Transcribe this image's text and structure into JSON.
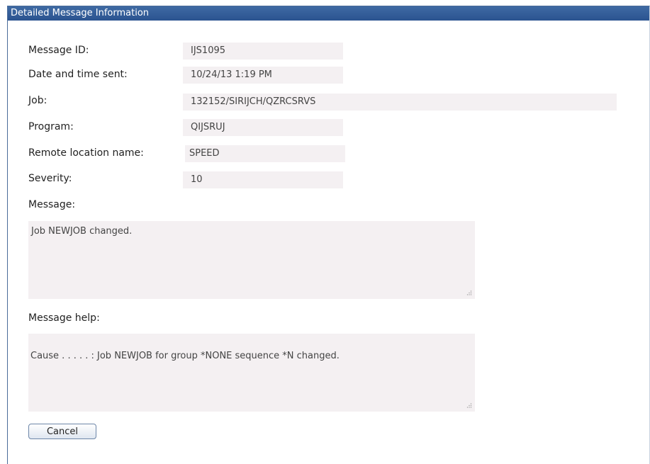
{
  "dialog": {
    "title": "Detailed Message Information"
  },
  "fields": {
    "message_id": {
      "label": "Message ID:",
      "value": "IJS1095"
    },
    "date_sent": {
      "label": "Date and time sent:",
      "value": "10/24/13 1:19 PM"
    },
    "job": {
      "label": "Job:",
      "value": "132152/SIRIJCH/QZRCSRVS"
    },
    "program": {
      "label": "Program:",
      "value": "QIJSRUJ"
    },
    "remote_location": {
      "label": "Remote location name:",
      "value": "SPEED"
    },
    "severity": {
      "label": "Severity:",
      "value": "10"
    }
  },
  "message": {
    "label": "Message:",
    "text": "Job NEWJOB changed."
  },
  "message_help": {
    "label": "Message help:",
    "text": "Cause . . . . . :   Job NEWJOB for group *NONE sequence *N changed."
  },
  "actions": {
    "cancel_label": "Cancel"
  }
}
